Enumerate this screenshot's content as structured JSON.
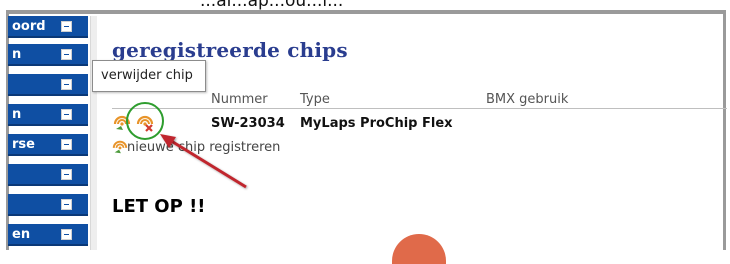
{
  "top_fragment": "...al...ap...ou...l...",
  "sidebar": {
    "items": [
      {
        "label": "oord"
      },
      {
        "label": "n"
      },
      {
        "label": ""
      },
      {
        "label": "n"
      },
      {
        "label": "rse"
      },
      {
        "label": ""
      },
      {
        "label": ""
      },
      {
        "label": "en"
      }
    ]
  },
  "page": {
    "title": "geregistreerde chips",
    "tooltip": "verwijder chip"
  },
  "table": {
    "headers": [
      "Nummer",
      "Type",
      "BMX gebruik"
    ],
    "rows": [
      {
        "nummer": "SW-23034",
        "type": "MyLaps ProChip Flex",
        "bmx": ""
      }
    ]
  },
  "register_link": "nieuwe chip registreren",
  "notice_title": "LET OP !!",
  "colors": {
    "sidebar_bg": "#0f4fa3",
    "title": "#2a3d8f",
    "highlight": "#2e9d2e",
    "arrow": "#c0272d"
  }
}
